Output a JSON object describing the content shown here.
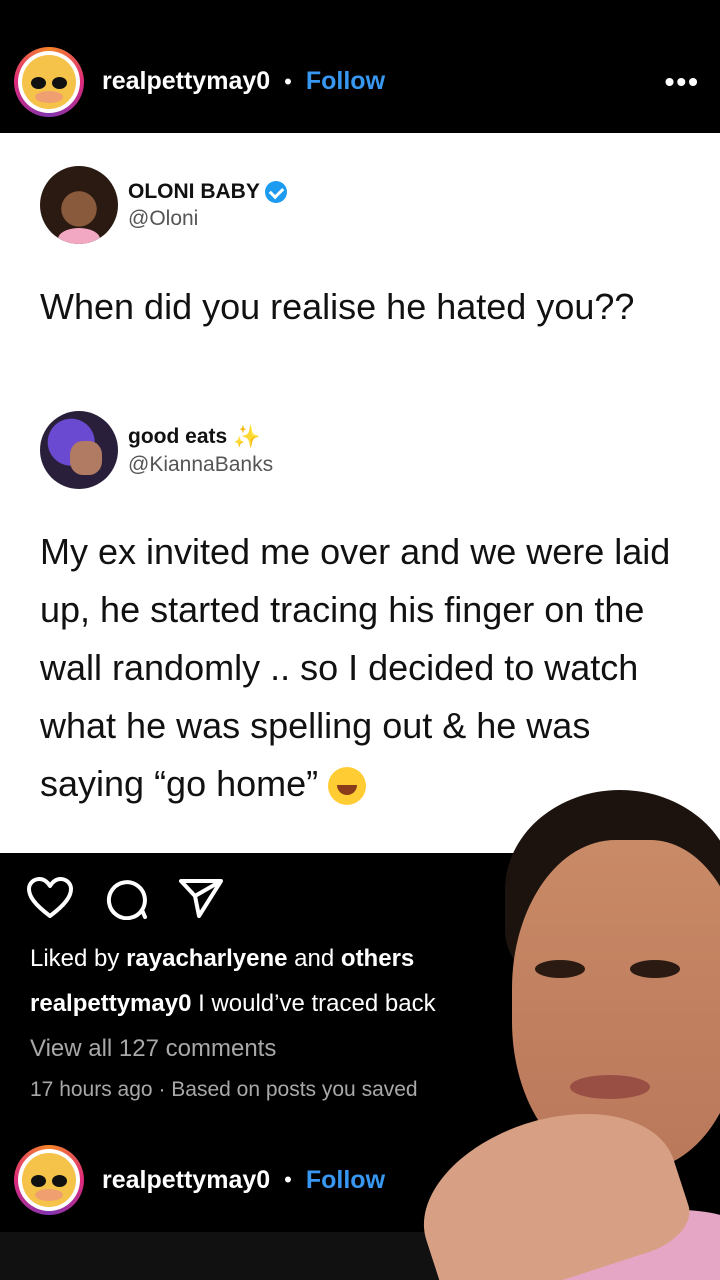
{
  "post": {
    "username": "realpettymay0",
    "dot": "•",
    "follow_label": "Follow",
    "more_label": "•••"
  },
  "tweet1": {
    "name": "OLONI BABY",
    "handle": "@Oloni",
    "text": "When did you realise he hated you??"
  },
  "tweet2": {
    "name": "good eats",
    "handle": "@KiannaBanks",
    "text": "My ex invited me over and we were laid up, he started tracing his finger on the wall randomly .. so I decided to watch what he was spelling out & he was saying “go home”"
  },
  "actions": {
    "like_icon": "heart-icon",
    "comment_icon": "comment-icon",
    "share_icon": "send-icon"
  },
  "meta": {
    "liked_prefix": "Liked by ",
    "liked_user": "rayacharlyene",
    "liked_and": " and ",
    "liked_others": "others",
    "caption_user": "realpettymay0",
    "caption_text": " I would’ve traced back",
    "view_comments": "View all 127 comments",
    "time": "17 hours ago",
    "time_sep": " · ",
    "saved_note": "Based on posts you saved"
  },
  "next_post": {
    "username": "realpettymay0",
    "dot": "•",
    "follow_label": "Follow"
  },
  "colors": {
    "follow": "#3897f0",
    "verified": "#1d9bf0"
  }
}
